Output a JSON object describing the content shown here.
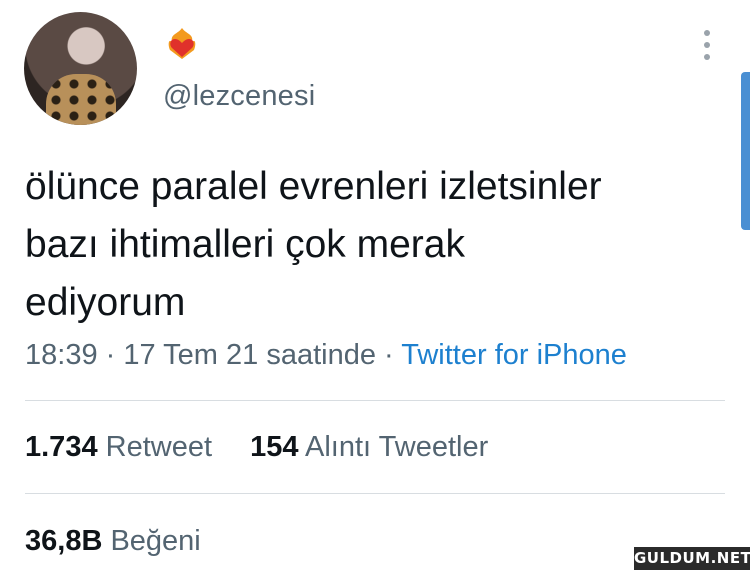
{
  "profile": {
    "handle": "@lezcenesi",
    "avatar_icon": "profile-avatar",
    "badge_icon": "flaming-heart-emoji"
  },
  "tweet": {
    "text_lines": [
      "ölünce paralel evrenleri izletsinler",
      "bazı ihtimalleri çok merak",
      "ediyorum"
    ],
    "time": "18:39",
    "sep1": "·",
    "date": "17 Tem 21 saatinde",
    "sep2": "·",
    "source": "Twitter for iPhone"
  },
  "stats": {
    "retweets_count": "1.734",
    "retweets_label": "Retweet",
    "quotes_count": "154",
    "quotes_label": "Alıntı Tweetler",
    "likes_count": "36,8B",
    "likes_label": "Beğeni"
  },
  "colors": {
    "link": "#1d80cf",
    "muted": "#536471",
    "text": "#0f1419"
  },
  "watermark": "GULDUM.NET"
}
